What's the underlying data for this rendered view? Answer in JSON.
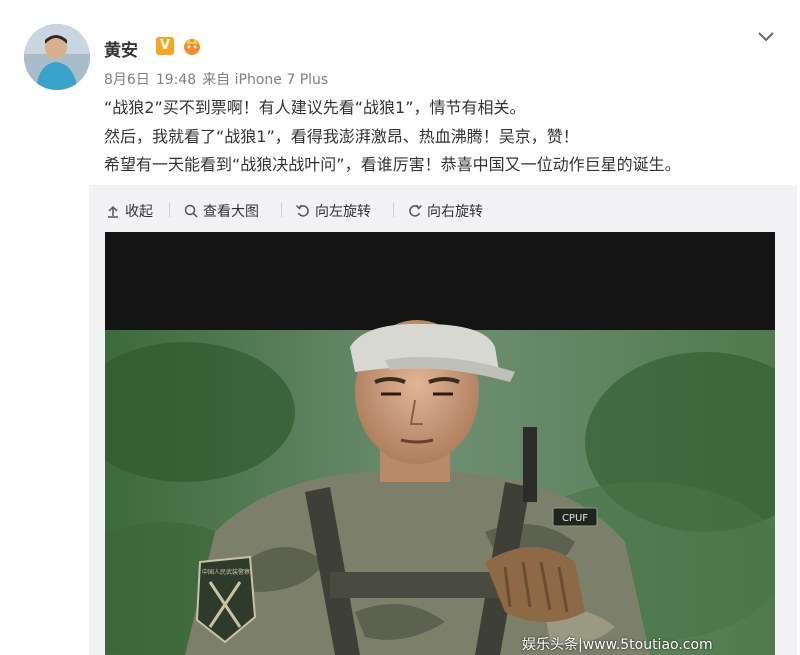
{
  "user": {
    "name": "黄安",
    "verified_badge": "V",
    "avatar_icon": "avatar-portrait"
  },
  "meta": {
    "date": "8月6日",
    "time": "19:48",
    "source": "来自 iPhone 7 Plus"
  },
  "post": {
    "lines": [
      "“战狼2”买不到票啊！有人建议先看“战狼1”，情节有相关。",
      "然后，我就看了“战狼1”，看得我澎湃激昂、热血沸腾！吴京，赞！",
      "希望有一天能看到“战狼决战叶问”，看谁厉害！恭喜中国又一位动作巨星的诞生。"
    ]
  },
  "toolbar": {
    "collapse": "收起",
    "view_large": "查看大图",
    "rotate_left": "向左旋转",
    "rotate_right": "向右旋转"
  },
  "photo": {
    "patch_cpuf": "CPUF",
    "patch_arm": "中国人民武装警察"
  },
  "watermark": "娱乐头条|www.5toutiao.com",
  "colors": {
    "panel_bg": "#f2f2f5",
    "verified": "#f5a623",
    "meta_text": "#808080"
  }
}
